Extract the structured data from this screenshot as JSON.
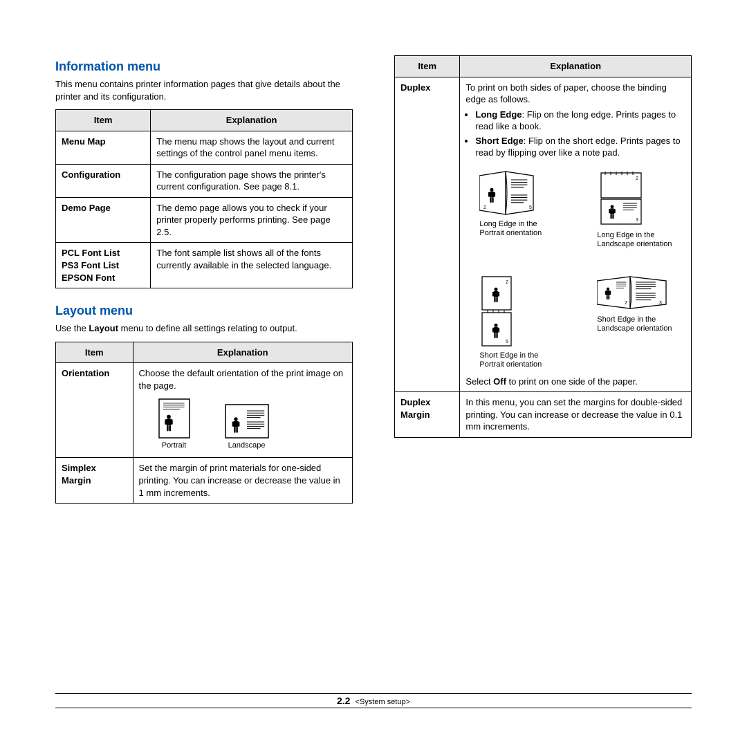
{
  "left": {
    "h1": "Information menu",
    "intro": "This menu contains printer information pages that give details about the printer and its configuration.",
    "tbl1": {
      "th1": "Item",
      "th2": "Explanation",
      "r1": {
        "item": "Menu Map",
        "exp": "The menu map shows the layout and current settings of the control panel menu items."
      },
      "r2": {
        "item": "Configuration",
        "exp": "The configuration page shows the printer's current configuration. See page 8.1."
      },
      "r3": {
        "item": "Demo Page",
        "exp": "The demo page allows you to check if your printer properly performs printing. See page 2.5."
      },
      "r4": {
        "item1": "PCL Font List",
        "item2": "PS3 Font List",
        "item3": "EPSON Font",
        "exp": "The font sample list shows all of the fonts currently available in the selected language."
      }
    },
    "h2": "Layout menu",
    "intro2_pre": "Use the ",
    "intro2_bold": "Layout",
    "intro2_post": " menu to define all settings relating to output.",
    "tbl2": {
      "th1": "Item",
      "th2": "Explanation",
      "r1": {
        "item": "Orientation",
        "exp": "Choose the default orientation of the print image on the page.",
        "cap1": "Portrait",
        "cap2": "Landscape"
      },
      "r2": {
        "item1": "Simplex",
        "item2": "Margin",
        "exp": "Set the margin of print materials for one-sided printing. You can increase or decrease the value in 1 mm increments."
      }
    }
  },
  "right": {
    "tbl": {
      "th1": "Item",
      "th2": "Explanation",
      "r1": {
        "item": "Duplex",
        "exp1": "To print on both sides of paper, choose the binding edge as follows.",
        "b1_bold": "Long Edge",
        "b1_rest": ": Flip on the long edge. Prints pages to read like a book.",
        "b2_bold": "Short Edge",
        "b2_rest": ": Flip on the short edge. Prints pages to read by flipping over like a note pad.",
        "cap1a": "Long Edge in the",
        "cap1b": "Portrait orientation",
        "cap2a": "Long Edge in the",
        "cap2b": "Landscape orientation",
        "cap3a": "Short Edge in the",
        "cap3b": "Portrait orientation",
        "cap4a": "Short Edge in the",
        "cap4b": "Landscape orientation",
        "exp2_pre": "Select ",
        "exp2_bold": "Off",
        "exp2_post": " to print on one side of the paper."
      },
      "r2": {
        "item1": "Duplex",
        "item2": "Margin",
        "exp": "In this menu, you can set the margins for double-sided printing. You can increase or decrease the value in 0.1 mm increments."
      }
    }
  },
  "footer": {
    "page": "2.2",
    "section": "<System setup>"
  }
}
